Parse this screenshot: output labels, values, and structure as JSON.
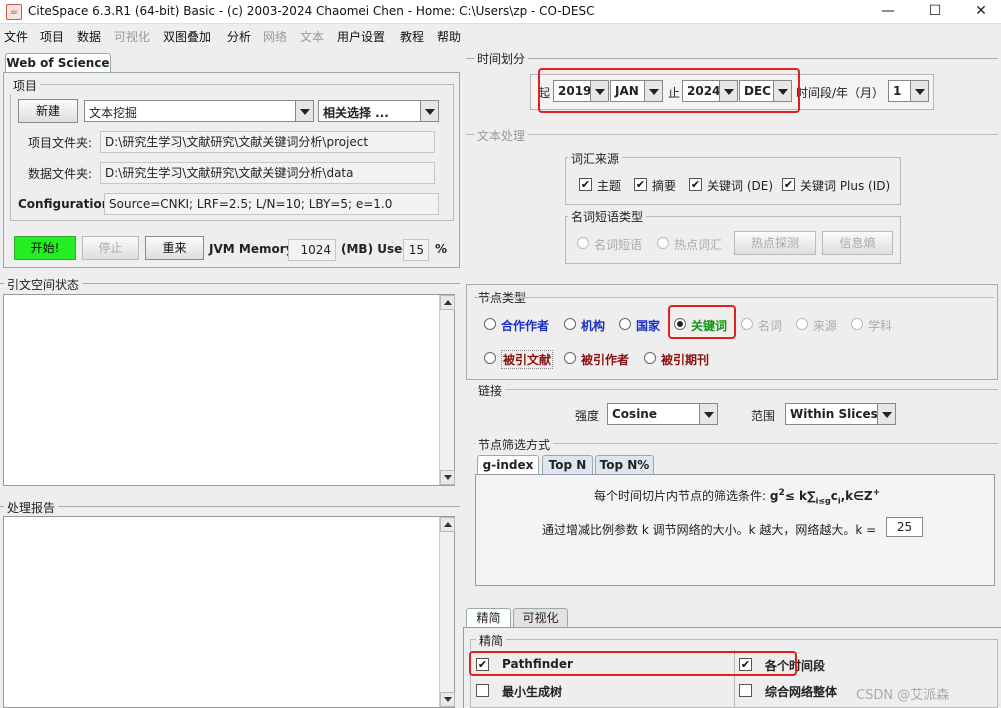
{
  "window": {
    "title": "CiteSpace 6.3.R1 (64-bit) Basic - (c) 2003-2024 Chaomei Chen - Home: C:\\Users\\zp - CO-DESC",
    "minimize": "—",
    "maximize": "☐",
    "close": "✕"
  },
  "menu": [
    "文件",
    "项目",
    "数据",
    "可视化",
    "双图叠加",
    "分析",
    "网络",
    "文本",
    "用户设置",
    "教程",
    "帮助"
  ],
  "left": {
    "source_tab": "Web of Science",
    "project_legend": "项目",
    "new_button": "新建",
    "project_select": "文本挖掘",
    "related_select": "相关选择 ...",
    "project_dir_label": "项目文件夹:",
    "project_dir_value": "D:\\研究生学习\\文献研究\\文献关键词分析\\project",
    "data_dir_label": "数据文件夹:",
    "data_dir_value": "D:\\研究生学习\\文献研究\\文献关键词分析\\data",
    "config_label": "Configuration:",
    "config_value": "Source=CNKI; LRF=2.5; L/N=10; LBY=5; e=1.0",
    "start_button": "开始!",
    "stop_button": "停止",
    "reset_button": "重来",
    "jvm_label": "JVM Memory",
    "jvm_value": "1024",
    "used_label": "(MB) Used",
    "used_value": "15",
    "percent": "%",
    "citation_status_legend": "引文空间状态",
    "process_report_legend": "处理报告"
  },
  "time_slicing": {
    "legend": "时间划分",
    "from_label": "起",
    "from_year": "2019",
    "from_month": "JAN",
    "to_label": "止",
    "to_year": "2024",
    "to_month": "DEC",
    "slice_label": "时间段/年（月）",
    "slice_value": "1"
  },
  "text_processing": {
    "legend": "文本处理",
    "term_source_legend": "词汇来源",
    "sources": [
      "主题",
      "摘要",
      "关键词 (DE)",
      "关键词 Plus (ID)"
    ],
    "term_type_legend": "名词短语类型",
    "noun_phrase": "名词短语",
    "burst_term": "热点词汇",
    "burst_detect_button": "热点探测",
    "entropy_button": "信息熵"
  },
  "node_types": {
    "legend": "节点类型",
    "row1": [
      {
        "label": "合作作者",
        "style": "blue"
      },
      {
        "label": "机构",
        "style": "blue"
      },
      {
        "label": "国家",
        "style": "blue"
      },
      {
        "label": "关键词",
        "style": "green",
        "selected": true
      },
      {
        "label": "名词",
        "style": "disabled"
      },
      {
        "label": "来源",
        "style": "disabled"
      },
      {
        "label": "学科",
        "style": "disabled"
      }
    ],
    "row2": [
      {
        "label": "被引文献",
        "style": "maroon"
      },
      {
        "label": "被引作者",
        "style": "maroon"
      },
      {
        "label": "被引期刊",
        "style": "maroon"
      }
    ]
  },
  "links": {
    "legend": "链接",
    "strength_label": "强度",
    "strength_value": "Cosine",
    "scope_label": "范围",
    "scope_value": "Within Slices"
  },
  "selection": {
    "legend": "节点筛选方式",
    "tabs": [
      "g-index",
      "Top N",
      "Top N%"
    ],
    "formula_prefix": "每个时间切片内节点的筛选条件:",
    "formula_g": "g",
    "formula_sup2": "2",
    "formula_mid": "≤ k∑",
    "formula_sub": "i≤g",
    "formula_c": "c",
    "formula_sub_i": "i",
    "formula_tail": ",k∈Z",
    "formula_sup_plus": "+",
    "k_desc": "通过增减比例参数 k 调节网络的大小。k 越大，网络越大。k =",
    "k_value": "25"
  },
  "pruning": {
    "tabs": [
      "精简",
      "可视化"
    ],
    "legend": "精简",
    "pathfinder": "Pathfinder",
    "mst": "最小生成树",
    "per_slice": "各个时间段",
    "merged": "综合网络整体"
  },
  "watermark": "CSDN @艾派森"
}
